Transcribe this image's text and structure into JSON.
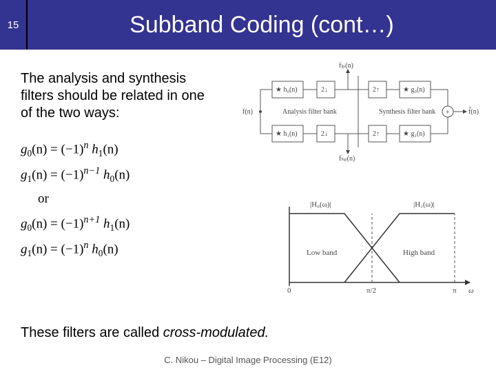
{
  "header": {
    "page_number": "15",
    "title": "Subband Coding (cont…)"
  },
  "intro_text": "The analysis and synthesis filters should be related in one of the two ways:",
  "equations": {
    "eq1_lhs": "g",
    "eq1_sub": "0",
    "eq1_arg": "(n) = (−1)",
    "eq1_exp": "n",
    "eq1_rhs": " h",
    "eq1_rsub": "1",
    "eq1_tail": "(n)",
    "eq2_lhs": "g",
    "eq2_sub": "1",
    "eq2_arg": "(n) = (−1)",
    "eq2_exp": "n−1",
    "eq2_rhs": " h",
    "eq2_rsub": "0",
    "eq2_tail": "(n)",
    "or": "or",
    "eq3_lhs": "g",
    "eq3_sub": "0",
    "eq3_arg": "(n) = (−1)",
    "eq3_exp": "n+1",
    "eq3_rhs": " h",
    "eq3_rsub": "1",
    "eq3_tail": "(n)",
    "eq4_lhs": "g",
    "eq4_sub": "1",
    "eq4_arg": "(n) = (−1)",
    "eq4_exp": "n",
    "eq4_rhs": " h",
    "eq4_rsub": "0",
    "eq4_tail": "(n)"
  },
  "diagram": {
    "input": "f(n)",
    "output": "f̂(n)",
    "h0": "★ h₀(n)",
    "h1": "★ h₁(n)",
    "g0": "★ g₀(n)",
    "g1": "★ g₁(n)",
    "down": "2↓",
    "up": "2↑",
    "flp": "fₗₚ(n)",
    "fhp": "fₕₚ(n)",
    "analysis": "Analysis filter bank",
    "synthesis": "Synthesis filter bank",
    "plus": "+"
  },
  "spectrum": {
    "H0": "|H₀(ω)|",
    "H1": "|H₁(ω)|",
    "low": "Low band",
    "high": "High band",
    "zero": "0",
    "pi2": "π/2",
    "pi": "π",
    "omega": "ω"
  },
  "closing_text_a": "These filters are called ",
  "closing_text_b": "cross-modulated.",
  "footer": "C. Nikou – Digital Image Processing (E12)"
}
